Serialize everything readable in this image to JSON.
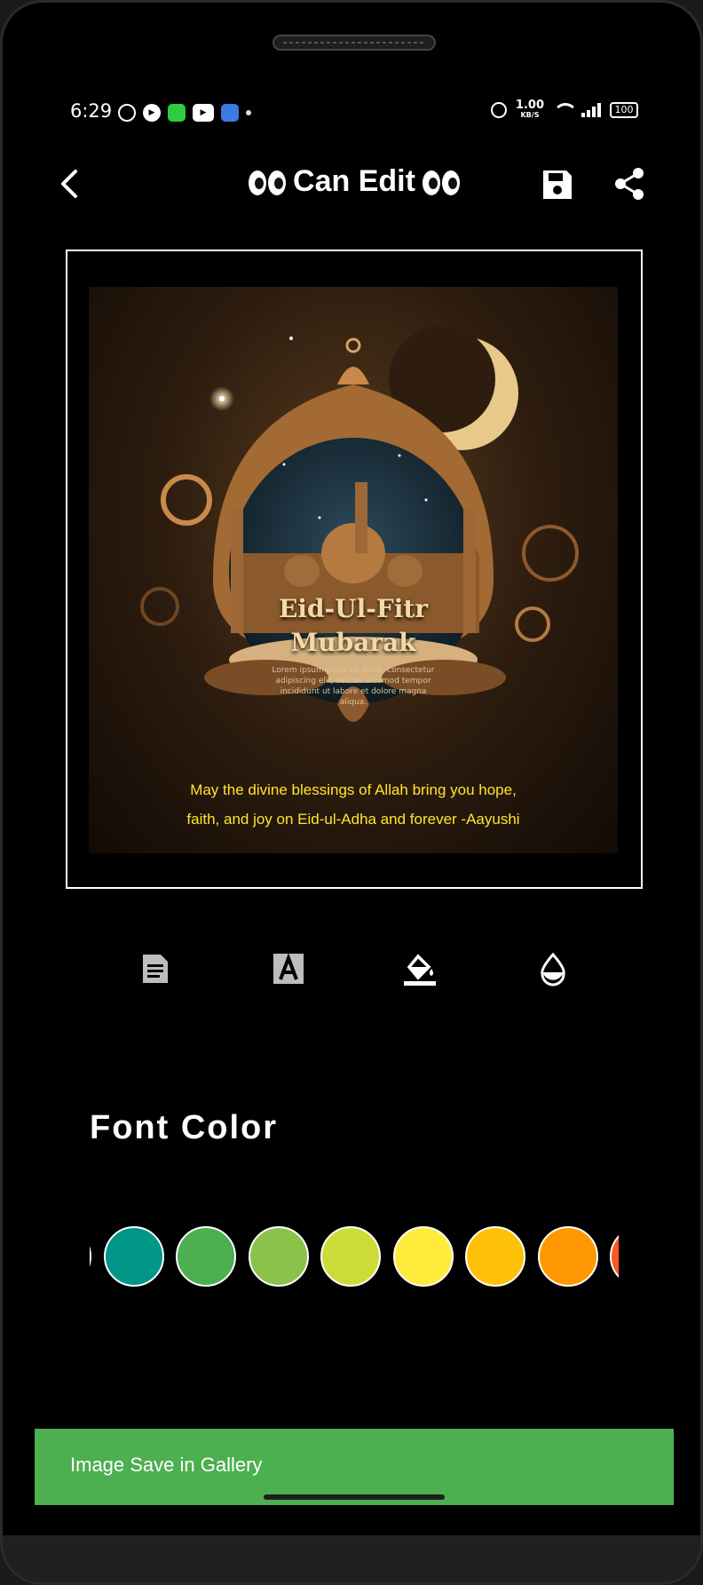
{
  "status_bar": {
    "time": "6:29",
    "speed_value": "1.00",
    "speed_unit": "KB/S",
    "battery": "100"
  },
  "app_bar": {
    "title": "Can Edit",
    "title_decoration_icon": "eyes-emoji-icon",
    "back_icon": "back-arrow-icon",
    "save_icon": "save-icon",
    "share_icon": "share-icon"
  },
  "poster": {
    "title_line1": "Eid-Ul-Fitr",
    "title_line2": "Mubarak",
    "lorem_text": "Lorem ipsum dolor sit amet, consectetur adipiscing elit, sed do eiusmod tempor incididunt ut labore et dolore magna aliqua.",
    "overlay_line1": "May the divine blessings of Allah bring you hope,",
    "overlay_line2": "faith, and joy on Eid-ul-Adha and forever -Aayushi",
    "overlay_color": "#ffe629"
  },
  "tools": [
    {
      "icon": "text-document-icon",
      "active": false
    },
    {
      "icon": "font-style-icon",
      "active": false
    },
    {
      "icon": "paint-bucket-icon",
      "active": true
    },
    {
      "icon": "opacity-drop-icon",
      "active": true
    }
  ],
  "font_color": {
    "heading": "Font Color",
    "swatches": [
      "#03a9f4",
      "#009688",
      "#4caf50",
      "#8bc34a",
      "#cddc39",
      "#ffeb3b",
      "#ffc107",
      "#ff9800",
      "#ff5722"
    ]
  },
  "snackbar": {
    "message": "Image Save in Gallery",
    "color": "#4caf50"
  }
}
